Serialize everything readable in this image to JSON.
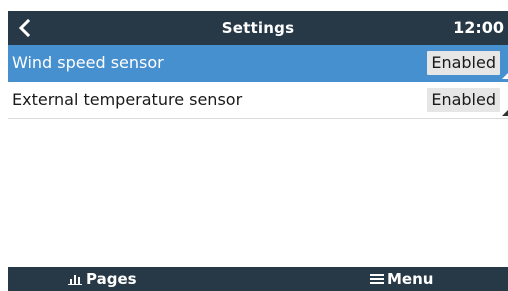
{
  "header": {
    "back_icon": "chevron-left-icon",
    "title": "Settings",
    "time": "12:00"
  },
  "settings": {
    "items": [
      {
        "label": "Wind speed sensor",
        "value": "Enabled",
        "selected": true
      },
      {
        "label": "External temperature sensor",
        "value": "Enabled",
        "selected": false
      }
    ]
  },
  "footer": {
    "pages_label": "Pages",
    "pages_icon": "bar-chart-icon",
    "menu_label": "Menu",
    "menu_icon": "hamburger-icon"
  },
  "colors": {
    "bar_background": "#273847",
    "selection": "#4790d0",
    "value_box": "#e6e6e6"
  }
}
